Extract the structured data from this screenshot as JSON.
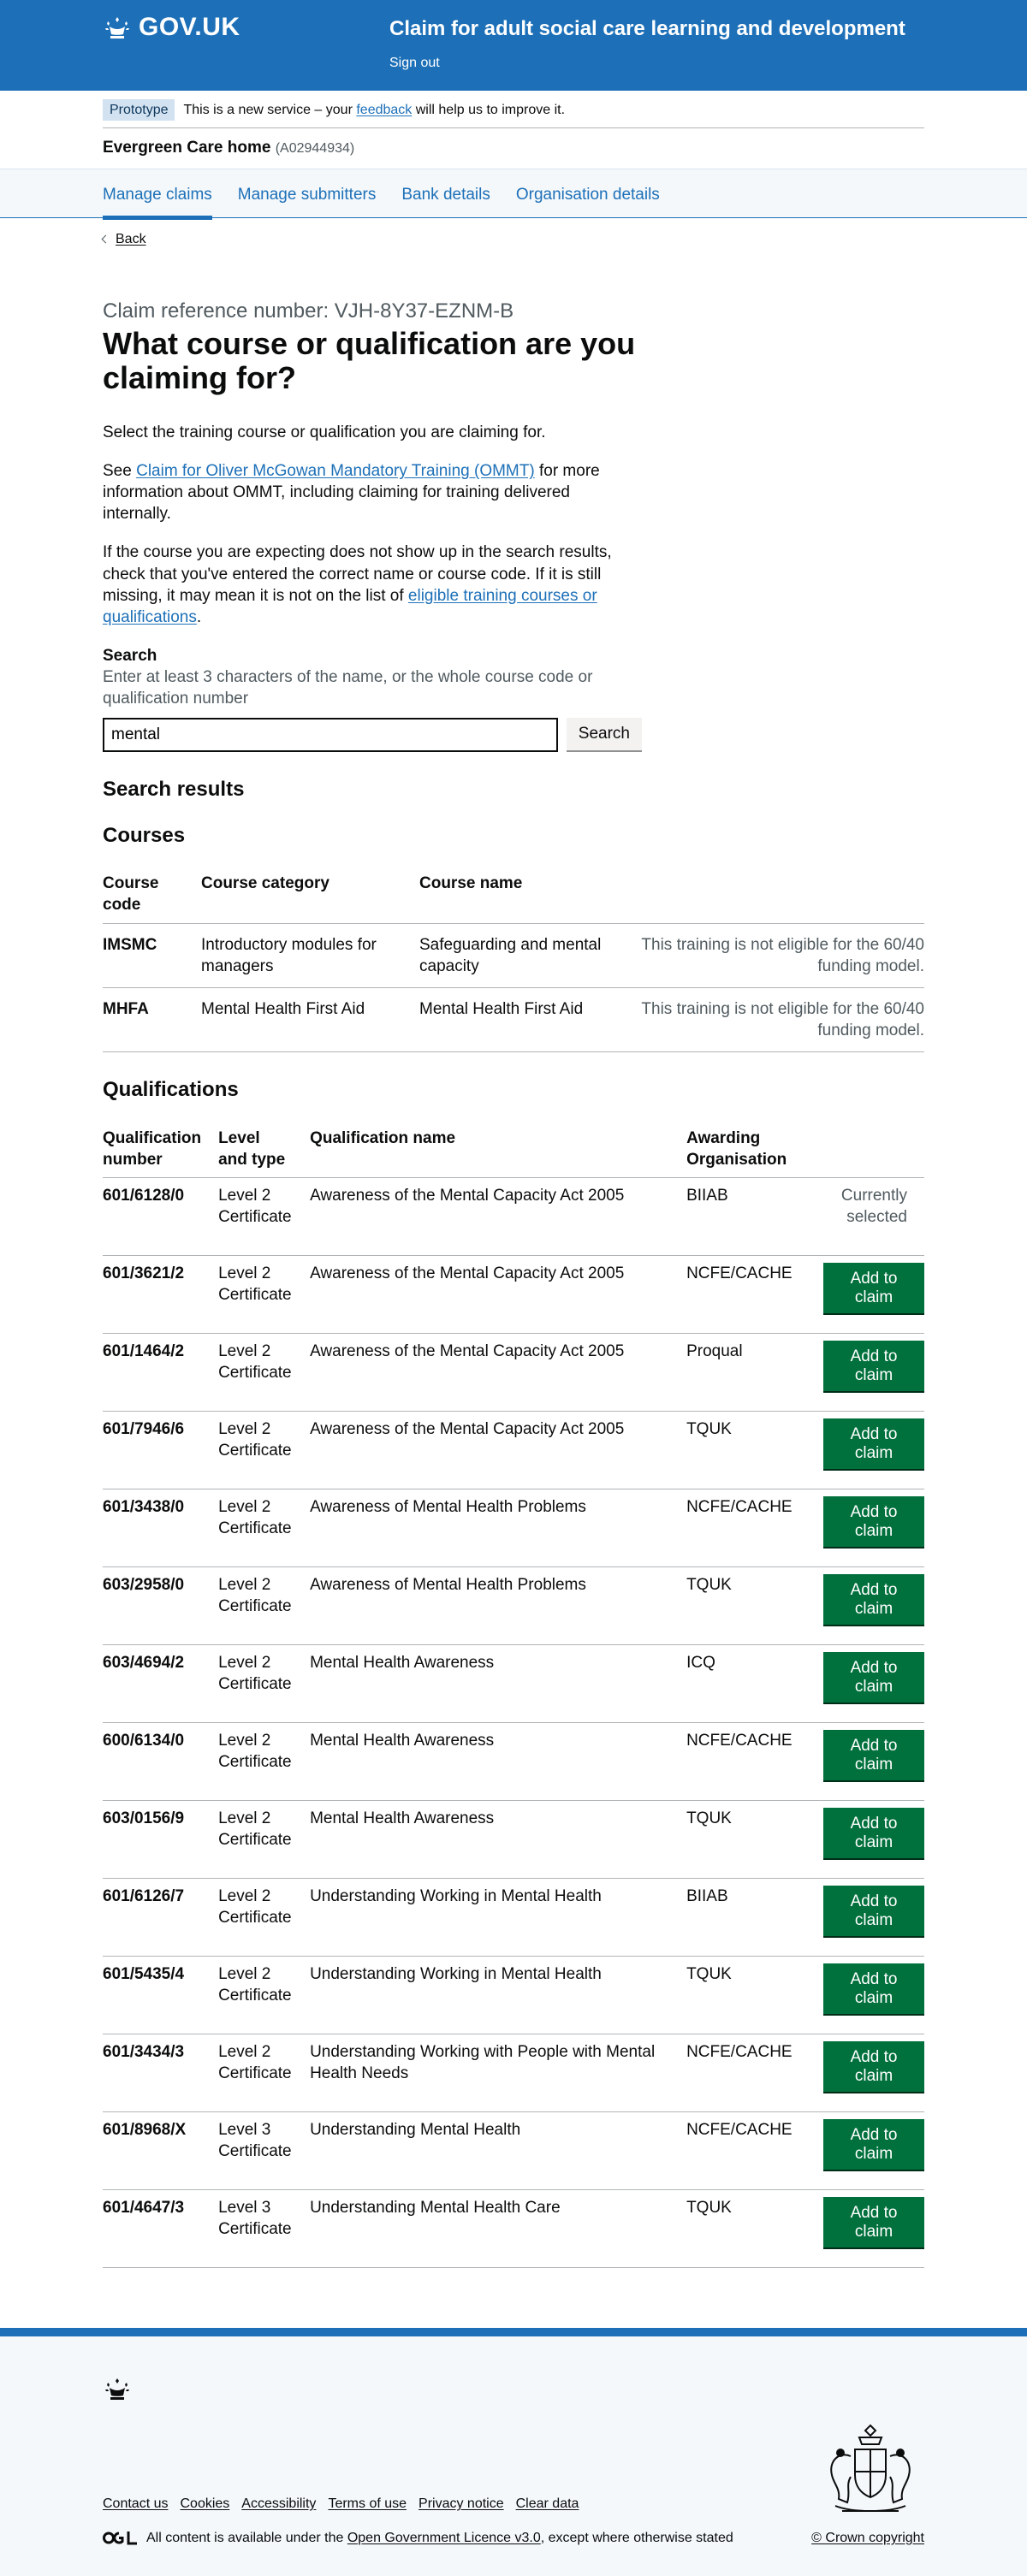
{
  "header": {
    "logo_text": "GOV.UK",
    "service_name": "Claim for adult social care learning and development",
    "sign_out": "Sign out"
  },
  "phase": {
    "tag": "Prototype",
    "text_before": "This is a new service – your",
    "link": "feedback",
    "text_after": "will help us to improve it."
  },
  "org": {
    "name": "Evergreen Care home",
    "id": "(A02944934)"
  },
  "nav": [
    {
      "label": "Manage claims"
    },
    {
      "label": "Manage submitters"
    },
    {
      "label": "Bank details"
    },
    {
      "label": "Organisation details"
    }
  ],
  "back": "Back",
  "caption": "Claim reference number: VJH-8Y37-EZNM-B",
  "title": "What course or qualification are you claiming for?",
  "intro": "Select the training course or qualification you are claiming for.",
  "ommt": {
    "before": "See",
    "link": "Claim for Oliver McGowan Mandatory Training (OMMT)",
    "after": "for more information about OMMT, including claiming for training delivered internally."
  },
  "missing": {
    "before": "If the course you are expecting does not show up in the search results, check that you've entered the correct name or course code. If it is still missing, it may mean it is not on the list of",
    "link": "eligible training courses or qualifications",
    "after": "."
  },
  "search": {
    "label": "Search",
    "hint": "Enter at least 3 characters of the name, or the whole course code or qualification number",
    "value": "mental",
    "button": "Search"
  },
  "results_heading": "Search results",
  "courses": {
    "heading": "Courses",
    "headers": [
      "Course code",
      "Course category",
      "Course name",
      ""
    ],
    "rows": [
      {
        "code": "IMSMC",
        "category": "Introductory modules for managers",
        "name": "Safeguarding and mental capacity",
        "note": "This training is not eligible for the 60/40 funding model."
      },
      {
        "code": "MHFA",
        "category": "Mental Health First Aid",
        "name": "Mental Health First Aid",
        "note": "This training is not eligible for the 60/40 funding model."
      }
    ]
  },
  "qualifications": {
    "heading": "Qualifications",
    "headers": [
      "Qualification number",
      "Level and type",
      "Qualification name",
      "Awarding Organisation",
      ""
    ],
    "add_label": "Add to claim",
    "selected_label": "Currently selected",
    "rows": [
      {
        "number": "601/6128/0",
        "level": "Level 2 Certificate",
        "name": "Awareness of the Mental Capacity Act 2005",
        "org": "BIIAB",
        "selected": true
      },
      {
        "number": "601/3621/2",
        "level": "Level 2 Certificate",
        "name": "Awareness of the Mental Capacity Act 2005",
        "org": "NCFE/CACHE",
        "selected": false
      },
      {
        "number": "601/1464/2",
        "level": "Level 2 Certificate",
        "name": "Awareness of the Mental Capacity Act 2005",
        "org": "Proqual",
        "selected": false
      },
      {
        "number": "601/7946/6",
        "level": "Level 2 Certificate",
        "name": "Awareness of the Mental Capacity Act 2005",
        "org": "TQUK",
        "selected": false
      },
      {
        "number": "601/3438/0",
        "level": "Level 2 Certificate",
        "name": "Awareness of Mental Health Problems",
        "org": "NCFE/CACHE",
        "selected": false
      },
      {
        "number": "603/2958/0",
        "level": "Level 2 Certificate",
        "name": "Awareness of Mental Health Problems",
        "org": "TQUK",
        "selected": false
      },
      {
        "number": "603/4694/2",
        "level": "Level 2 Certificate",
        "name": "Mental Health Awareness",
        "org": "ICQ",
        "selected": false
      },
      {
        "number": "600/6134/0",
        "level": "Level 2 Certificate",
        "name": "Mental Health Awareness",
        "org": "NCFE/CACHE",
        "selected": false
      },
      {
        "number": "603/0156/9",
        "level": "Level 2 Certificate",
        "name": "Mental Health Awareness",
        "org": "TQUK",
        "selected": false
      },
      {
        "number": "601/6126/7",
        "level": "Level 2 Certificate",
        "name": "Understanding Working in Mental Health",
        "org": "BIIAB",
        "selected": false
      },
      {
        "number": "601/5435/4",
        "level": "Level 2 Certificate",
        "name": "Understanding Working in Mental Health",
        "org": "TQUK",
        "selected": false
      },
      {
        "number": "601/3434/3",
        "level": "Level 2 Certificate",
        "name": "Understanding Working with People with Mental Health Needs",
        "org": "NCFE/CACHE",
        "selected": false
      },
      {
        "number": "601/8968/X",
        "level": "Level 3 Certificate",
        "name": "Understanding Mental Health",
        "org": "NCFE/CACHE",
        "selected": false
      },
      {
        "number": "601/4647/3",
        "level": "Level 3 Certificate",
        "name": "Understanding Mental Health Care",
        "org": "TQUK",
        "selected": false
      }
    ]
  },
  "footer": {
    "links": [
      "Contact us",
      "Cookies",
      "Accessibility",
      "Terms of use",
      "Privacy notice",
      "Clear data"
    ],
    "licence_before": "All content is available under the",
    "licence_link": "Open Government Licence v3.0",
    "licence_after": ", except where otherwise stated",
    "copyright": "© Crown copyright"
  },
  "colors": {
    "brand_blue": "#1d70b8",
    "button_green": "#00703c",
    "text": "#0b0c0c",
    "secondary_text": "#505a5f"
  }
}
